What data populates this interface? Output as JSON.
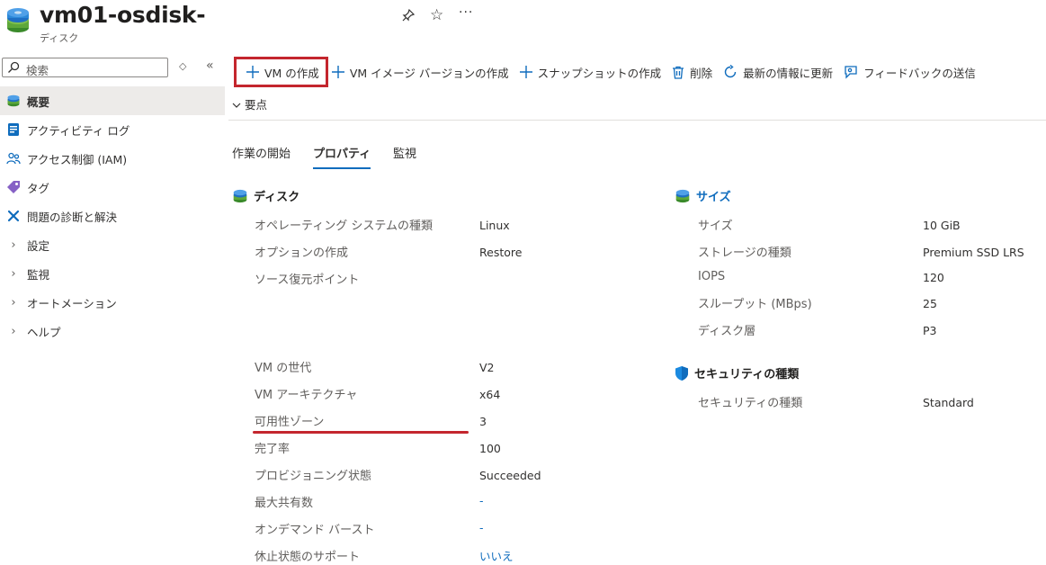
{
  "header": {
    "title": "vm01-osdisk-",
    "subtitle": "ディスク"
  },
  "sidebar": {
    "search_placeholder": "検索",
    "items": [
      {
        "label": "概要",
        "icon": "disk-icon",
        "active": true
      },
      {
        "label": "アクティビティ ログ",
        "icon": "activity-log-icon"
      },
      {
        "label": "アクセス制御 (IAM)",
        "icon": "iam-people-icon"
      },
      {
        "label": "タグ",
        "icon": "tag-icon"
      },
      {
        "label": "問題の診断と解決",
        "icon": "wrench-icon"
      },
      {
        "label": "設定",
        "icon": "chevron-right-icon"
      },
      {
        "label": "監視",
        "icon": "chevron-right-icon"
      },
      {
        "label": "オートメーション",
        "icon": "chevron-right-icon"
      },
      {
        "label": "ヘルプ",
        "icon": "chevron-right-icon"
      }
    ]
  },
  "toolbar": {
    "create_vm": "VM の作成",
    "create_image": "VM イメージ バージョンの作成",
    "create_snapshot": "スナップショットの作成",
    "delete": "削除",
    "refresh": "最新の情報に更新",
    "feedback": "フィードバックの送信"
  },
  "essentials_label": "要点",
  "tabs": [
    "作業の開始",
    "プロパティ",
    "監視"
  ],
  "disk_section": {
    "title": "ディスク",
    "rows": [
      {
        "label": "オペレーティング システムの種類",
        "value": "Linux"
      },
      {
        "label": "オプションの作成",
        "value": "Restore"
      },
      {
        "label": "ソース復元ポイント",
        "value": ""
      },
      {
        "label": "VM の世代",
        "value": "V2"
      },
      {
        "label": "VM アーキテクチャ",
        "value": "x64"
      },
      {
        "label": "可用性ゾーン",
        "value": "3"
      },
      {
        "label": "完了率",
        "value": "100"
      },
      {
        "label": "プロビジョニング状態",
        "value": "Succeeded"
      },
      {
        "label": "最大共有数",
        "value": "-"
      },
      {
        "label": "オンデマンド バースト",
        "value": "-"
      },
      {
        "label": "休止状態のサポート",
        "value": "いいえ"
      }
    ]
  },
  "size_section": {
    "title": "サイズ",
    "rows": [
      {
        "label": "サイズ",
        "value": "10 GiB"
      },
      {
        "label": "ストレージの種類",
        "value": "Premium SSD LRS"
      },
      {
        "label": "IOPS",
        "value": "120"
      },
      {
        "label": "スループット (MBps)",
        "value": "25"
      },
      {
        "label": "ディスク層",
        "value": "P3"
      }
    ]
  },
  "security_section": {
    "title": "セキュリティの種類",
    "rows": [
      {
        "label": "セキュリティの種類",
        "value": "Standard"
      }
    ]
  },
  "colors": {
    "accent": "#0f6cbd",
    "highlight": "#c4262e"
  }
}
